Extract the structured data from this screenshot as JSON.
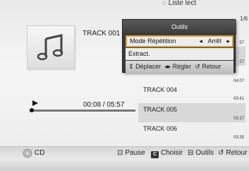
{
  "header": {
    "partial_title": "Liste lect",
    "page": "1/6"
  },
  "now_playing": {
    "track": "TRACK 001",
    "time": "00:08 / 05:57",
    "progress": 0.022
  },
  "playlist": [
    {
      "title": "",
      "duration": "57"
    },
    {
      "title": "",
      "duration": "27"
    },
    {
      "title": "",
      "duration": "04:07"
    },
    {
      "title": "TRACK 004",
      "duration": "03:41"
    },
    {
      "title": "TRACK 005",
      "duration": "03:17"
    },
    {
      "title": "TRACK 006",
      "duration": "03:35"
    }
  ],
  "popup": {
    "title": "Outils",
    "option_label": "Mode Répétition",
    "option_value": "Arrêt",
    "extract_label": "Extract.",
    "hint_move": "Déplacer",
    "hint_adjust": "Régler",
    "hint_back": "Retour"
  },
  "footer": {
    "source": "CD",
    "pause": "Pause",
    "choose_key": "C",
    "choose": "Choisir",
    "tools": "Outils",
    "back": "Retour"
  },
  "colors": {
    "selection_border": "#d8a038",
    "popup_bg": "#3a3a3a",
    "row_alt": "#d8d8d8"
  }
}
